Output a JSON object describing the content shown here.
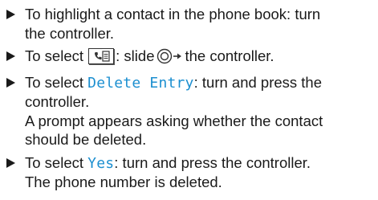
{
  "steps": [
    {
      "text": "To highlight a contact in the phone book: turn the controller.",
      "line1": "To highlight a contact in the phone book: turn",
      "line2": "the controller."
    },
    {
      "pre": "To select",
      "icon": "phone-book-icon",
      "mid": ": slide",
      "controller_icon": "controller-slide-right-icon",
      "post": "the controller."
    },
    {
      "pre": "To select",
      "term": "Delete Entry",
      "post_line1": ": turn and press the",
      "post_line2": "controller.",
      "result_line1": "A prompt appears asking whether the contact",
      "result_line2": "should be deleted."
    },
    {
      "pre": "To select",
      "term": "Yes",
      "post": ": turn and press the controller.",
      "result": "The phone number is deleted."
    }
  ],
  "colors": {
    "text": "#1a1a1a",
    "menu_term": "#1c8fd0"
  }
}
